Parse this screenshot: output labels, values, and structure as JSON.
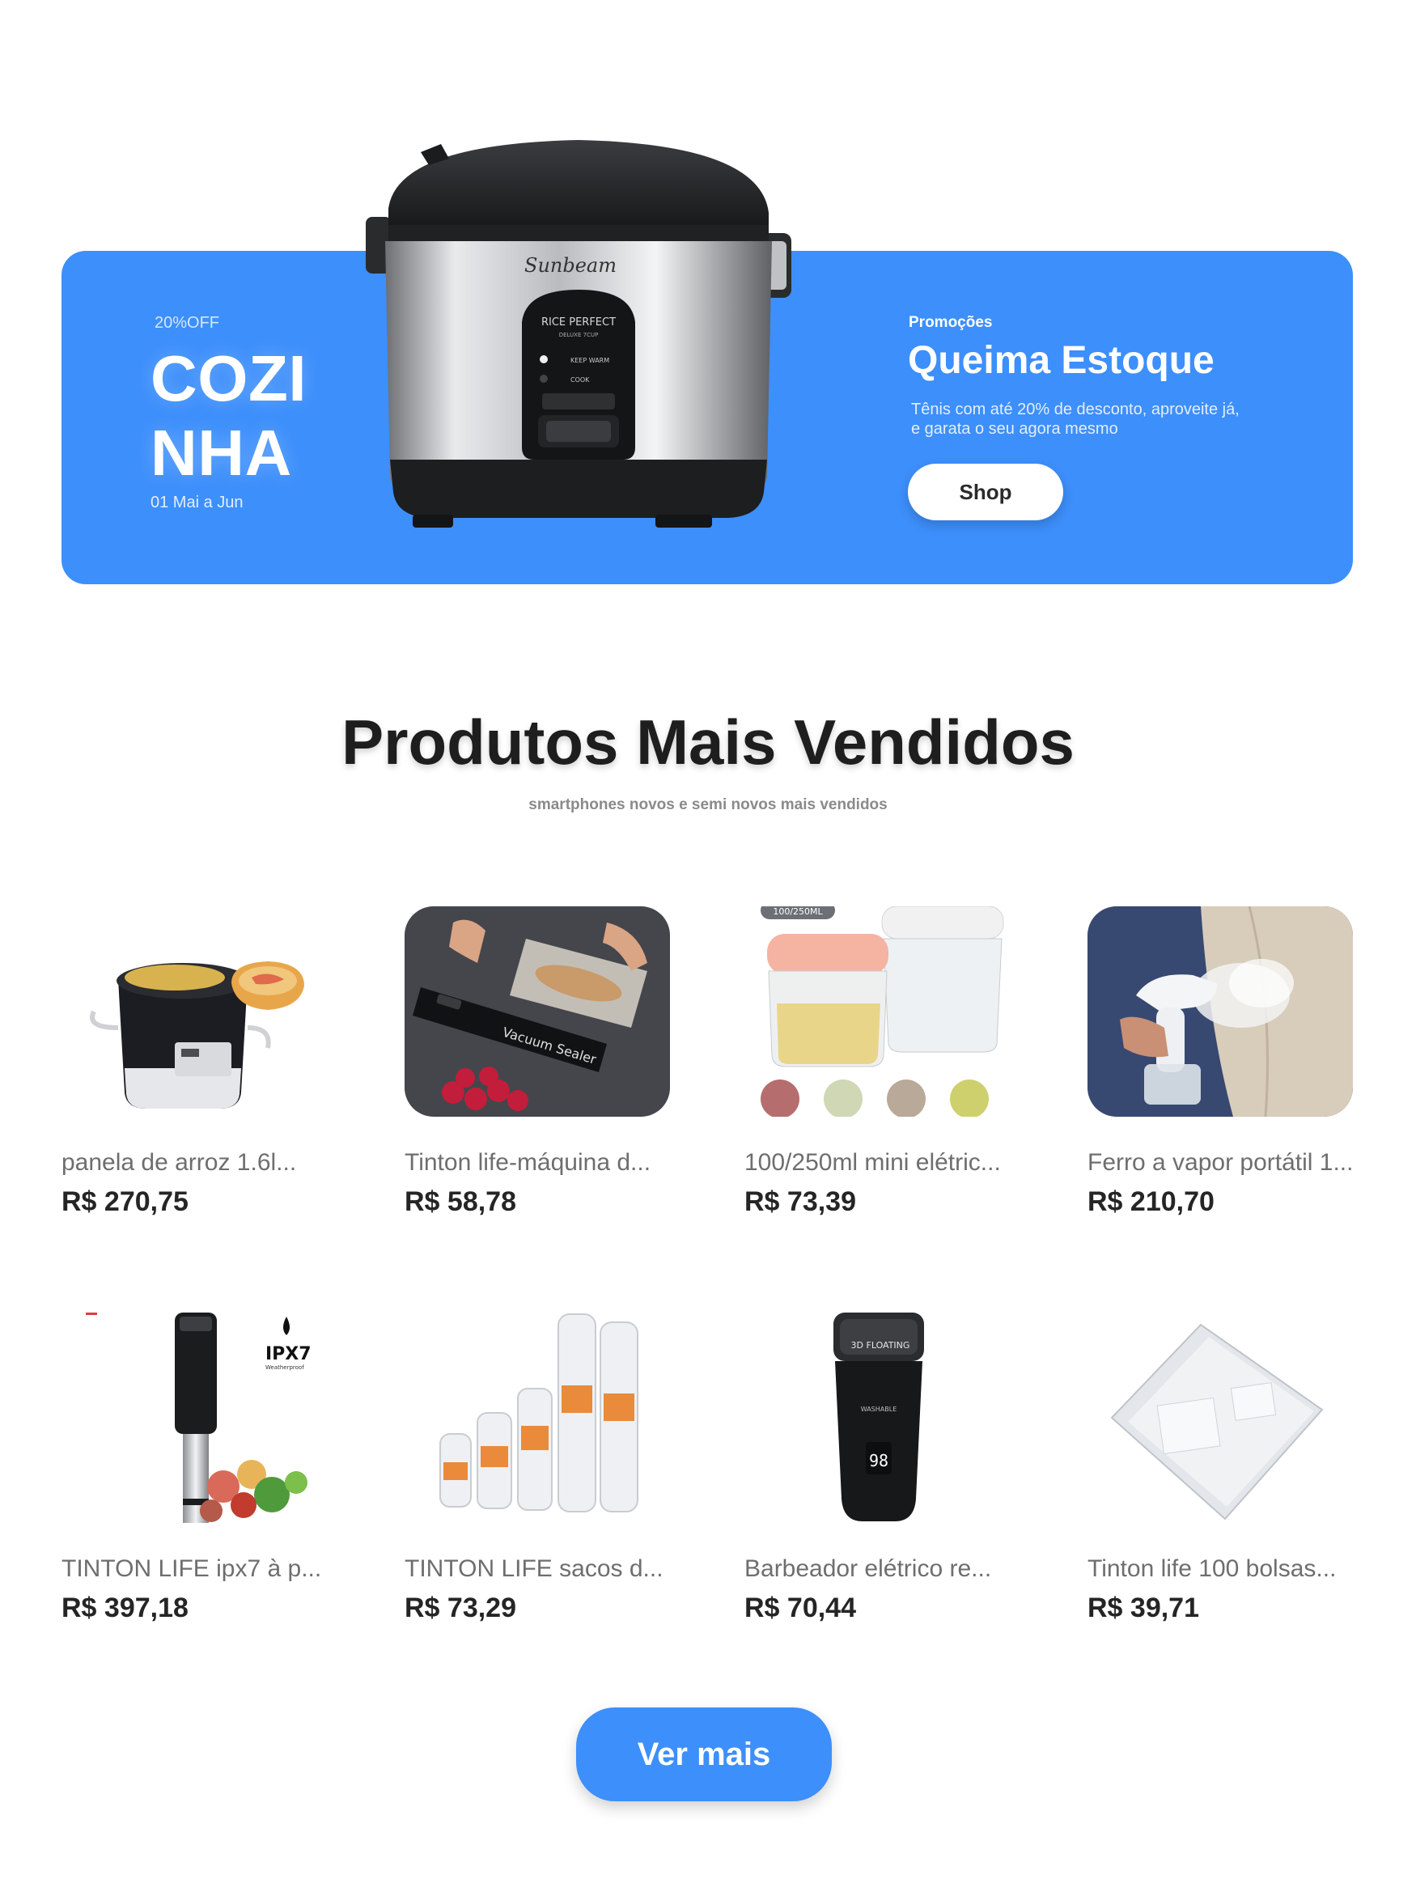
{
  "banner": {
    "discount": "20%OFF",
    "category_line1": "COZI",
    "category_line2": "NHA",
    "date_range": "01 Mai a Jun",
    "product_brand": "Sunbeam",
    "product_model": "RICE PERFECT",
    "product_model_sub": "DELUXE 7CUP",
    "keep_warm": "KEEP WARM",
    "cook": "COOK",
    "promo_label": "Promoções",
    "promo_title": "Queima Estoque",
    "promo_description": "Tênis com até 20% de desconto, aproveite já, e garata o seu agora mesmo",
    "shop_button": "Shop",
    "accent_color": "#3d8ffb"
  },
  "best_sellers": {
    "title": "Produtos Mais Vendidos",
    "subtitle": "smartphones novos e semi novos mais vendidos",
    "products": [
      {
        "name": "panela de arroz 1.6l...",
        "price": "R$ 270,75",
        "icon": "rice-cooker-pot"
      },
      {
        "name": "Tinton life-máquina d...",
        "price": "R$ 58,78",
        "icon": "vacuum-sealer",
        "image_text": "Vacuum Sealer"
      },
      {
        "name": "100/250ml mini elétric...",
        "price": "R$ 73,39",
        "icon": "mini-chopper",
        "image_badge": "100/250ML"
      },
      {
        "name": "Ferro a vapor portátil 1...",
        "price": "R$ 210,70",
        "icon": "steam-iron"
      },
      {
        "name": "TINTON LIFE ipx7 à p...",
        "price": "R$ 397,18",
        "icon": "sous-vide",
        "image_badge": "IPX7",
        "image_badge_sub": "Weatherproof"
      },
      {
        "name": "TINTON LIFE sacos d...",
        "price": "R$ 73,29",
        "icon": "vacuum-rolls"
      },
      {
        "name": "Barbeador elétrico re...",
        "price": "R$ 70,44",
        "icon": "electric-shaver",
        "image_text": "3D FLOATING",
        "image_text_2": "WASHABLE",
        "image_display": "98"
      },
      {
        "name": "Tinton life 100 bolsas...",
        "price": "R$ 39,71",
        "icon": "vacuum-bags"
      }
    ],
    "more_button": "Ver mais"
  }
}
